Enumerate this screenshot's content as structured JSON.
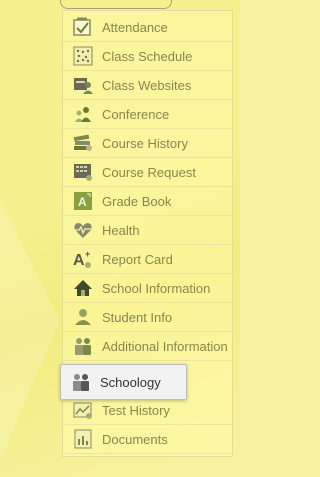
{
  "menu": {
    "items": [
      {
        "label": "Attendance",
        "icon": "checkbox-icon"
      },
      {
        "label": "Class Schedule",
        "icon": "calendar-dots-icon"
      },
      {
        "label": "Class Websites",
        "icon": "website-user-icon"
      },
      {
        "label": "Conference",
        "icon": "conference-people-icon"
      },
      {
        "label": "Course History",
        "icon": "books-icon"
      },
      {
        "label": "Course Request",
        "icon": "keyboard-icon"
      },
      {
        "label": "Grade Book",
        "icon": "grade-book-icon"
      },
      {
        "label": "Health",
        "icon": "heart-pulse-icon"
      },
      {
        "label": "Report Card",
        "icon": "a-plus-icon"
      },
      {
        "label": "School Information",
        "icon": "school-house-icon"
      },
      {
        "label": "Student Info",
        "icon": "student-icon"
      },
      {
        "label": "Additional Information",
        "icon": "people-icon"
      },
      {
        "label": "Schoology",
        "icon": "people-icon",
        "selected": true
      },
      {
        "label": "Test History",
        "icon": "test-chart-icon"
      },
      {
        "label": "Documents",
        "icon": "documents-icon"
      }
    ]
  },
  "colors": {
    "background": "#f6f08e",
    "menu_text": "#8a8550",
    "selected_bg": "#f2f2f2",
    "selected_text": "#333333",
    "icon_olive": "#7a8a4a",
    "icon_dark": "#3a3a2a"
  }
}
